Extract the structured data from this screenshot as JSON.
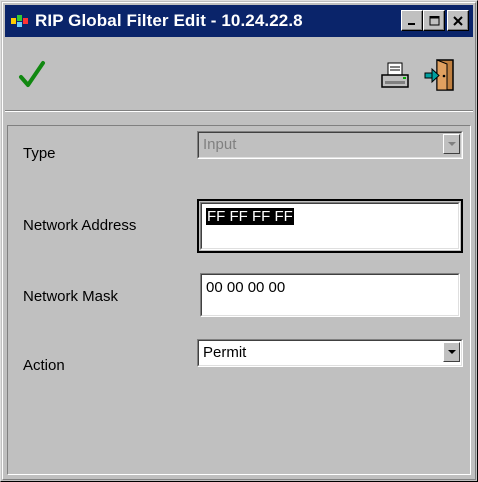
{
  "window": {
    "title": "RIP Global Filter Edit - 10.24.22.8",
    "accent_color": "#0a246a",
    "icon": "app-icon",
    "minimize_label": "_",
    "maximize_label": "□",
    "close_label": "✕"
  },
  "toolbar": {
    "apply_icon": "check-icon",
    "apply_glyph": "✓",
    "apply_color": "#118811",
    "print_icon": "printer-icon",
    "exit_icon": "exit-door-icon"
  },
  "form": {
    "type": {
      "label": "Type",
      "value": "Input",
      "disabled": true
    },
    "network_address": {
      "label": "Network Address",
      "value": "FF FF FF FF",
      "selected": true
    },
    "network_mask": {
      "label": "Network Mask",
      "value": "00 00 00 00"
    },
    "action": {
      "label": "Action",
      "value": "Permit"
    }
  }
}
